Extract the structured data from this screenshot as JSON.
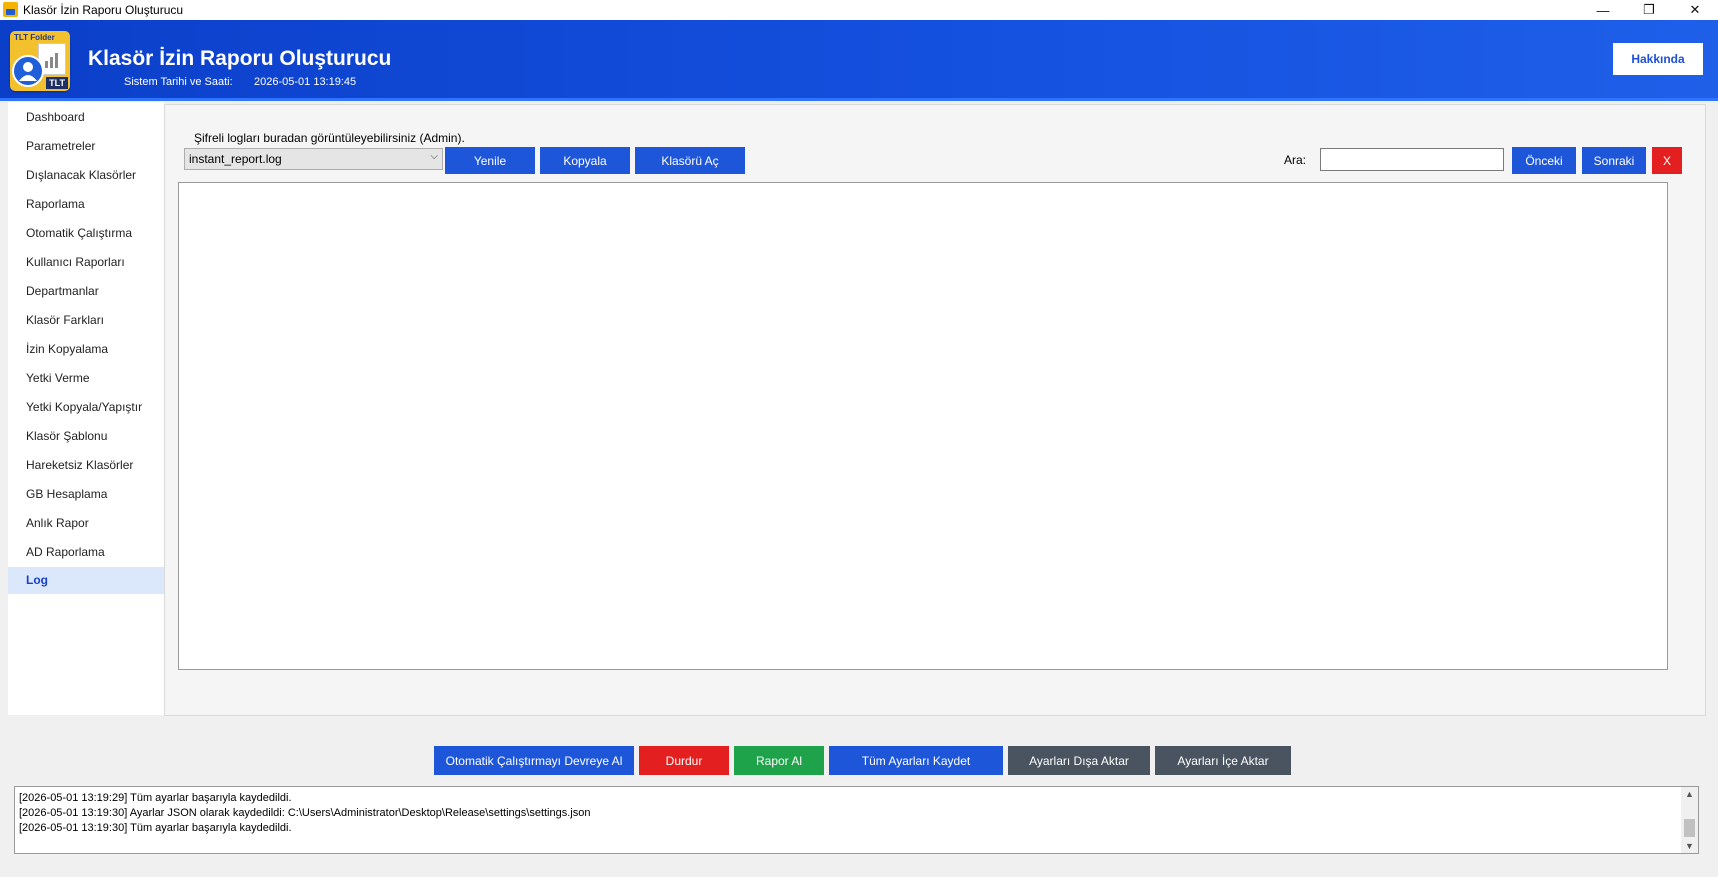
{
  "window": {
    "title": "Klasör İzin Raporu Oluşturucu",
    "minimize": "—",
    "restore": "❐",
    "close": "✕"
  },
  "header": {
    "logo_label": "TLT Folder",
    "logo_badge": "TLT",
    "title": "Klasör İzin Raporu Oluşturucu",
    "system_label": "Sistem Tarihi ve Saati:",
    "system_value": "2026-05-01 13:19:45",
    "about_label": "Hakkında"
  },
  "sidebar": {
    "items": [
      {
        "label": "Dashboard"
      },
      {
        "label": "Parametreler"
      },
      {
        "label": "Dışlanacak Klasörler"
      },
      {
        "label": "Raporlama"
      },
      {
        "label": "Otomatik Çalıştırma"
      },
      {
        "label": "Kullanıcı Raporları"
      },
      {
        "label": "Departmanlar"
      },
      {
        "label": "Klasör Farkları"
      },
      {
        "label": "İzin Kopyalama"
      },
      {
        "label": "Yetki Verme"
      },
      {
        "label": "Yetki Kopyala/Yapıştır"
      },
      {
        "label": "Klasör Şablonu"
      },
      {
        "label": "Hareketsiz Klasörler"
      },
      {
        "label": "GB Hesaplama"
      },
      {
        "label": "Anlık Rapor"
      },
      {
        "label": "AD Raporlama"
      },
      {
        "label": "Log"
      }
    ],
    "active": "Log"
  },
  "log": {
    "info": "Şifreli logları buradan görüntüleyebilirsiniz (Admin).",
    "file_select": "instant_report.log",
    "refresh_label": "Yenile",
    "copy_label": "Kopyala",
    "open_folder_label": "Klasörü Aç",
    "search_label": "Ara:",
    "search_value": "",
    "prev_label": "Önceki",
    "next_label": "Sonraki",
    "clear_label": "X"
  },
  "actions": {
    "auto_run": "Otomatik Çalıştırmayı Devreye Al",
    "stop": "Durdur",
    "report": "Rapor Al",
    "save_all": "Tüm Ayarları Kaydet",
    "export": "Ayarları Dışa Aktar",
    "import": "Ayarları İçe Aktar"
  },
  "console": {
    "lines": [
      "[2026-05-01 13:19:29] Tüm ayarlar başarıyla kaydedildi.",
      "[2026-05-01 13:19:30] Ayarlar JSON olarak kaydedildi: C:\\Users\\Administrator\\Desktop\\Release\\settings\\settings.json",
      "[2026-05-01 13:19:30] Tüm ayarlar başarıyla kaydedildi."
    ]
  }
}
